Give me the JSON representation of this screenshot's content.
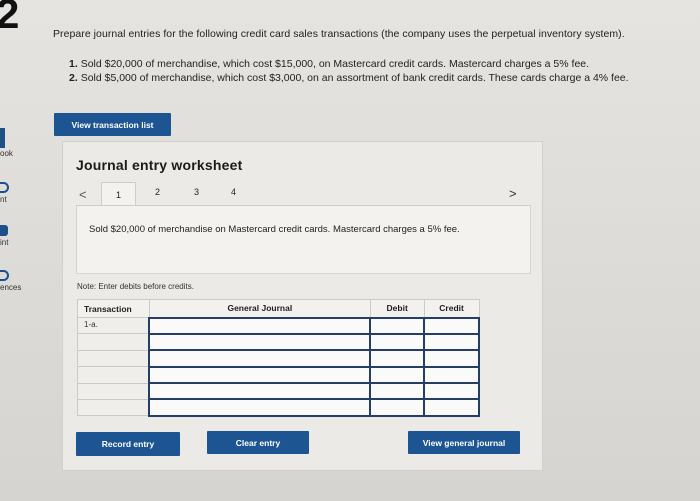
{
  "sidebar": {
    "step_number": "2",
    "items": [
      {
        "label": "ook"
      },
      {
        "label": "nt"
      },
      {
        "label": "int"
      },
      {
        "label": "ences"
      }
    ]
  },
  "instructions": "Prepare journal entries for the following credit card sales transactions (the company uses the perpetual inventory system).",
  "transactions": [
    {
      "num": "1.",
      "text": "Sold $20,000 of merchandise, which cost $15,000, on Mastercard credit cards. Mastercard charges a 5% fee."
    },
    {
      "num": "2.",
      "text": "Sold $5,000 of merchandise, which cost $3,000, on an assortment of bank credit cards. These cards charge a 4% fee."
    }
  ],
  "buttons": {
    "view_transaction_list": "View transaction list",
    "record_entry": "Record entry",
    "clear_entry": "Clear entry",
    "view_general_journal": "View general journal"
  },
  "worksheet": {
    "title": "Journal entry worksheet",
    "tabs": [
      "1",
      "2",
      "3",
      "4"
    ],
    "active_tab": "1",
    "prev_glyph": "<",
    "next_glyph": ">",
    "description": "Sold $20,000 of merchandise on Mastercard credit cards. Mastercard charges a 5% fee.",
    "note": "Note: Enter debits before credits.",
    "table": {
      "headers": {
        "transaction": "Transaction",
        "general_journal": "General Journal",
        "debit": "Debit",
        "credit": "Credit"
      },
      "transaction_id": "1-a."
    }
  },
  "colors": {
    "accent": "#1c5592",
    "input_border": "#243e68"
  }
}
